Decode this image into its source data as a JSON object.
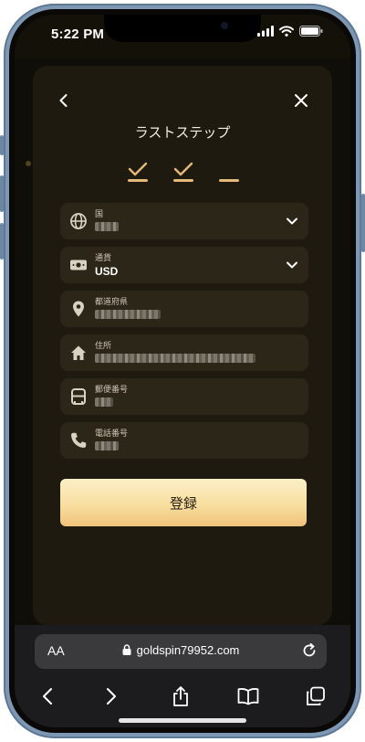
{
  "status_bar": {
    "time": "5:22 PM"
  },
  "modal": {
    "title": "ラストステップ",
    "fields": [
      {
        "icon": "globe-icon",
        "label": "国",
        "value": ""
      },
      {
        "icon": "cash-icon",
        "label": "通貨",
        "value": "USD"
      },
      {
        "icon": "location-pin-icon",
        "label": "都道府県",
        "value": ""
      },
      {
        "icon": "home-icon",
        "label": "住所",
        "value": ""
      },
      {
        "icon": "mailbox-icon",
        "label": "郵便番号",
        "value": ""
      },
      {
        "icon": "phone-icon",
        "label": "電話番号",
        "value": ""
      }
    ],
    "submit_label": "登録"
  },
  "browser": {
    "aa_label": "AA",
    "url": "goldspin79952.com"
  },
  "colors": {
    "accent": "#e5b97a",
    "modal_bg": "#1f1a10",
    "field_bg": "#2c2618"
  }
}
